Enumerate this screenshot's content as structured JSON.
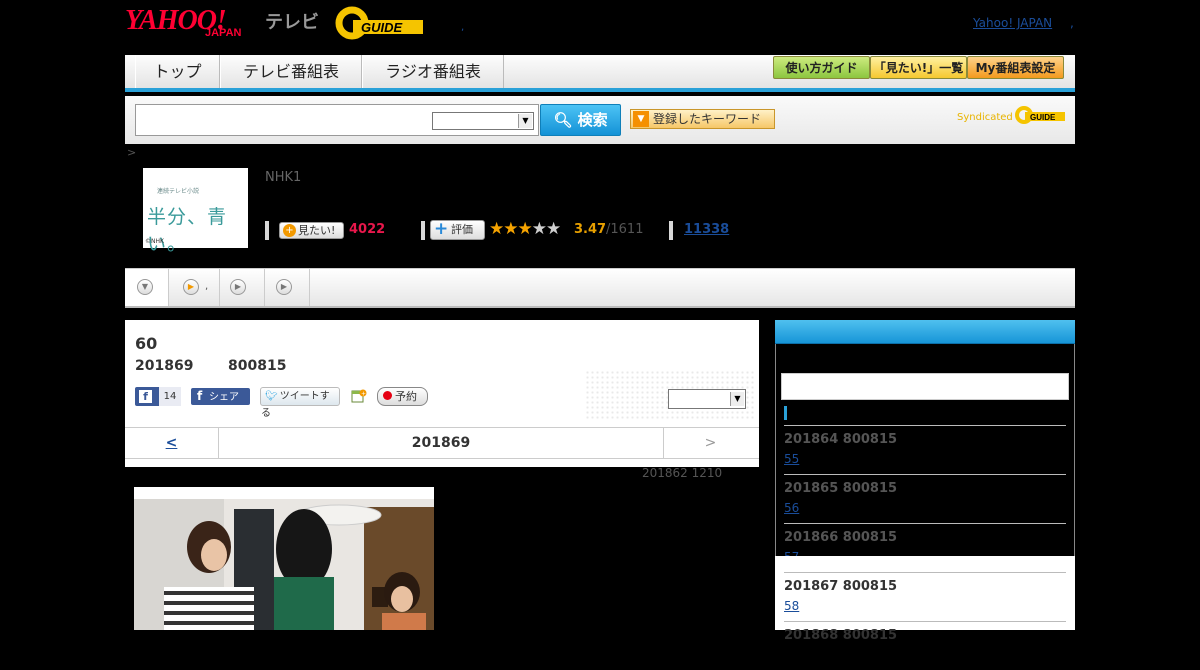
{
  "header": {
    "yahoo_logo": "YAHOO!",
    "japan_logo": "JAPAN",
    "tv_label": "テレビ",
    "gguide_logo": "G GUIDE",
    "sep": ",",
    "yahoo_japan_link": "Yahoo! JAPAN",
    "sep2": ","
  },
  "nav": {
    "tabs": [
      "トップ",
      "テレビ番組表",
      "ラジオ番組表"
    ],
    "buttons": [
      "使い方ガイド",
      "「見たい!」一覧",
      "My番組表設定"
    ],
    "colors": {
      "accent": "#2aa1d8",
      "btn_green": "#a8d84a",
      "btn_yellow": "#ffd24a",
      "btn_orange": "#f7a832"
    }
  },
  "search": {
    "input_value": "",
    "select_value": "",
    "button_label": "検索",
    "keyword_button": "登録したキーワード",
    "syndicated": "Syndicated"
  },
  "breadcrumb": ">",
  "program": {
    "thumb_small": "連続テレビ小説",
    "thumb_title": "半分、青い。",
    "thumb_credit": "©NHK",
    "channel": "NHK1",
    "mitai_label": "見たい!",
    "mitai_count": "4022",
    "hyoka_label": "評価",
    "rating_value": 3.47,
    "rating_stars": 3,
    "score": "3.47",
    "score_total": "/1611",
    "review_count": "11338"
  },
  "episode_tabs": {
    "tab2_dot": ","
  },
  "episode": {
    "number": "60",
    "date": "201869",
    "time": "800815",
    "fb_like_count": "14",
    "fb_share": "シェア",
    "tweet": "ツイートする",
    "yoyaku": "予約",
    "select_value": "",
    "pager_prev": "<",
    "pager_current": "201869",
    "pager_next": ">",
    "updated": "201862  1210"
  },
  "sidebar": {
    "items": [
      {
        "date": "201864  800815",
        "ep": "55"
      },
      {
        "date": "201865  800815",
        "ep": "56"
      },
      {
        "date": "201866  800815",
        "ep": "57"
      },
      {
        "date": "201867  800815",
        "ep": "58"
      },
      {
        "date": "201868  800815",
        "ep": ""
      }
    ]
  }
}
